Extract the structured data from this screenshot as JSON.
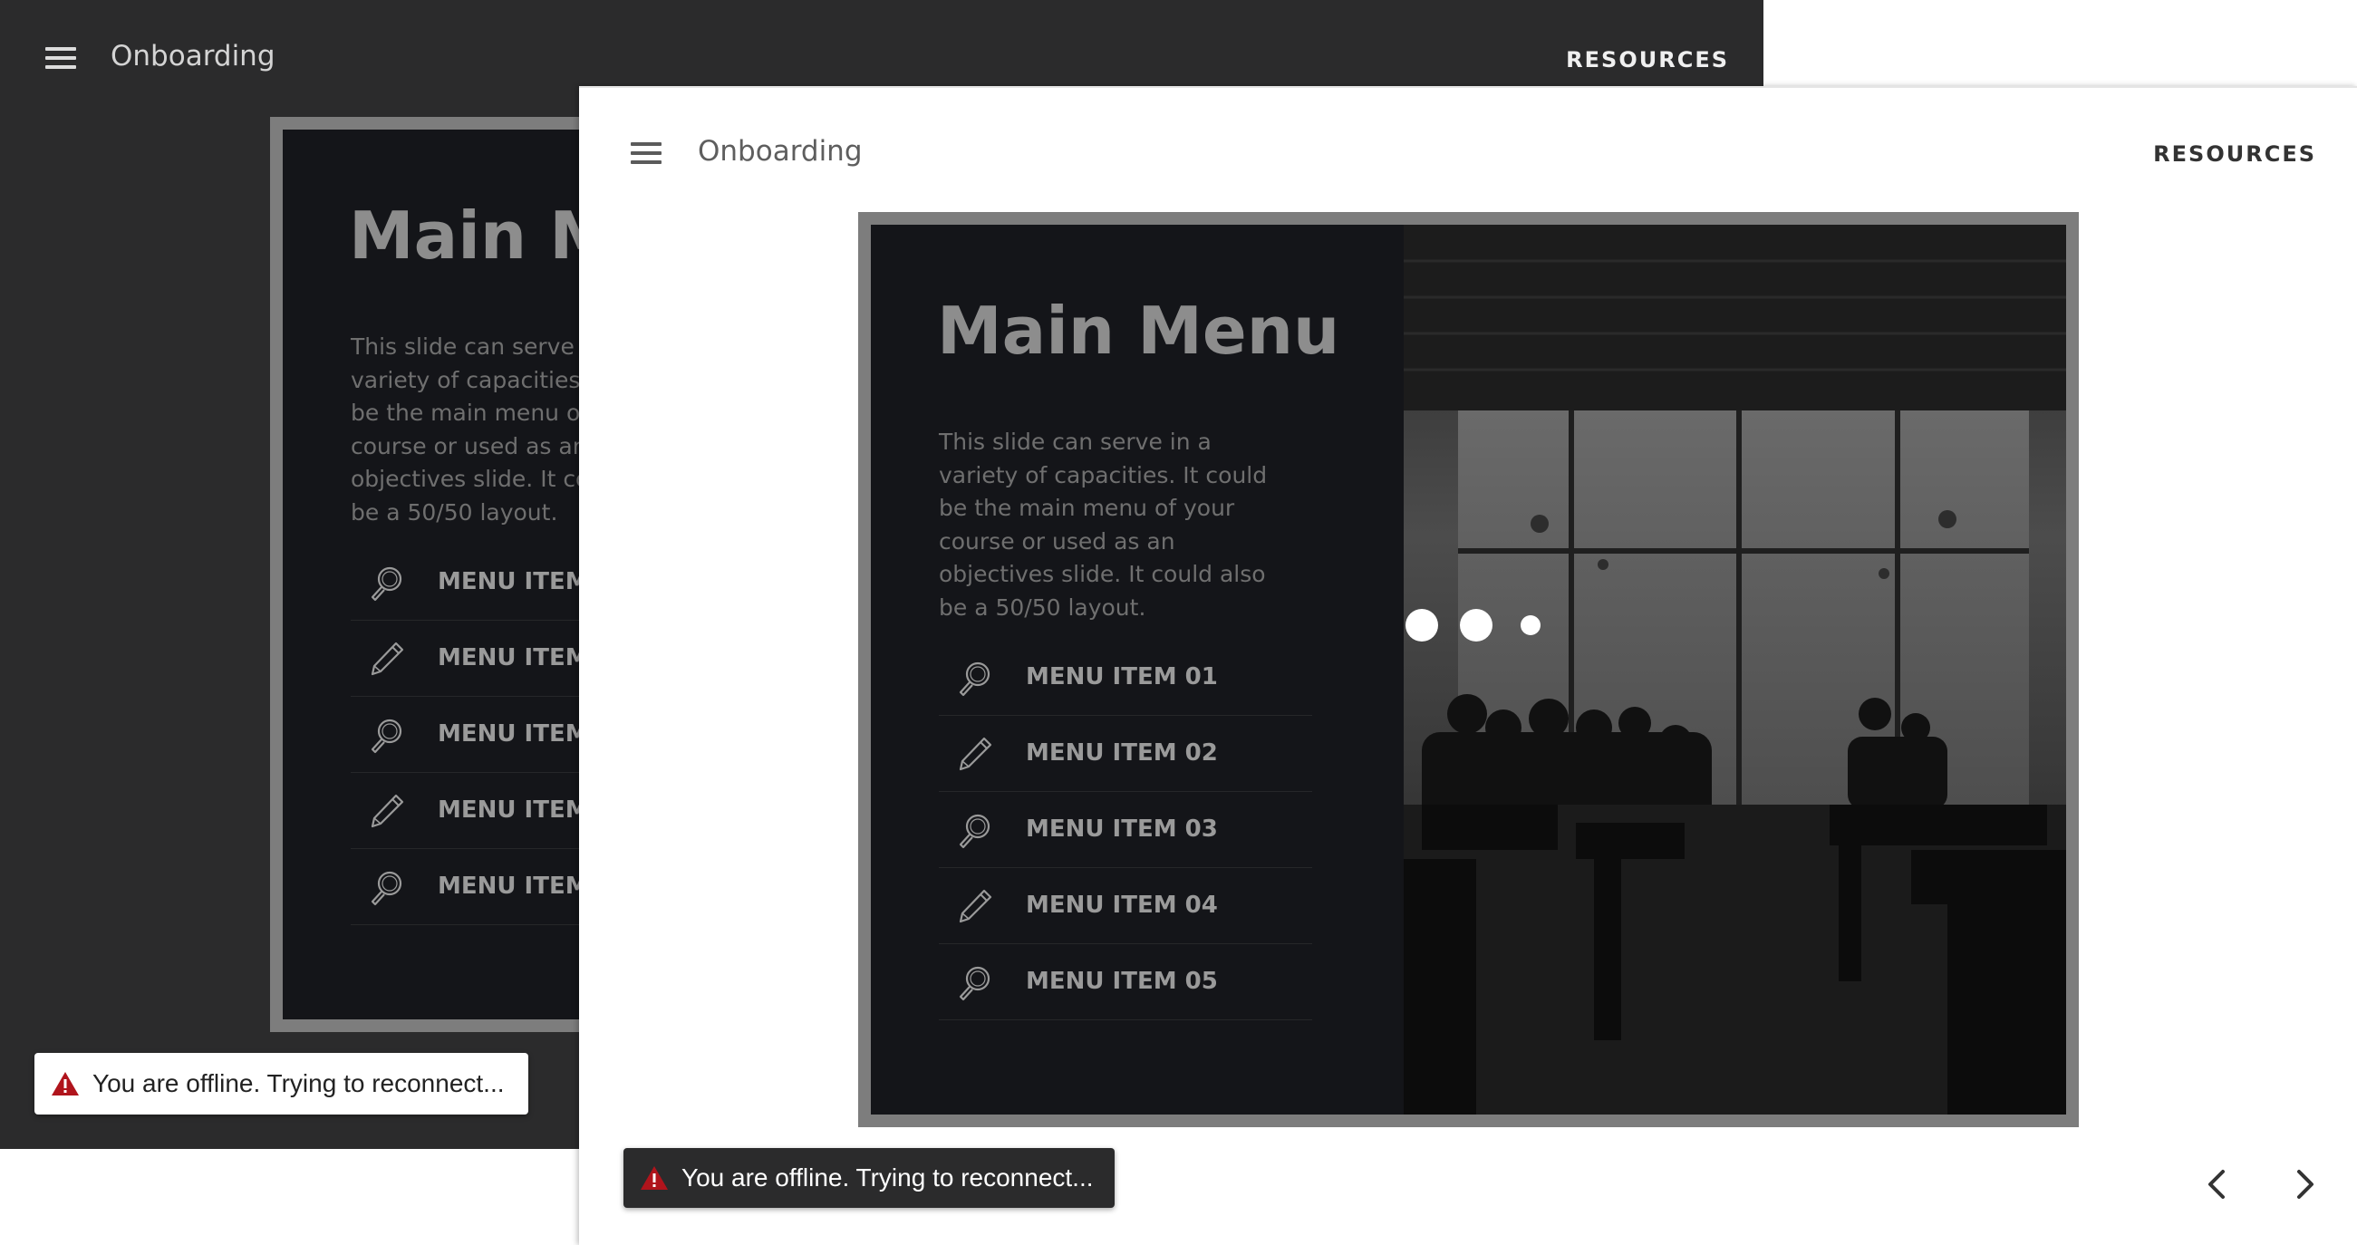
{
  "app": {
    "title": "Onboarding",
    "resources_label": "RESOURCES"
  },
  "slide": {
    "title": "Main Menu",
    "body": "This slide can serve in a variety of capacities. It could be the main menu of your course or used as an objectives slide. It could also be a 50/50 layout.",
    "menu_items": [
      {
        "label": "MENU ITEM 01",
        "icon": "magnifier-icon"
      },
      {
        "label": "MENU ITEM 02",
        "icon": "pencil-icon"
      },
      {
        "label": "MENU ITEM 03",
        "icon": "magnifier-icon"
      },
      {
        "label": "MENU ITEM 04",
        "icon": "pencil-icon"
      },
      {
        "label": "MENU ITEM 05",
        "icon": "magnifier-icon"
      }
    ]
  },
  "status": {
    "offline_message": "You are offline. Trying to reconnect..."
  },
  "colors": {
    "back_window_bg": "#2b2b2c",
    "slide_bg": "#141519",
    "slide_frame": "#7d7d7d",
    "warning_red": "#b0141c"
  },
  "icons": {
    "menu": "hamburger-icon",
    "warning": "warning-triangle-icon",
    "prev": "chevron-left-icon",
    "next": "chevron-right-icon",
    "loading": "loading-dots-icon"
  }
}
